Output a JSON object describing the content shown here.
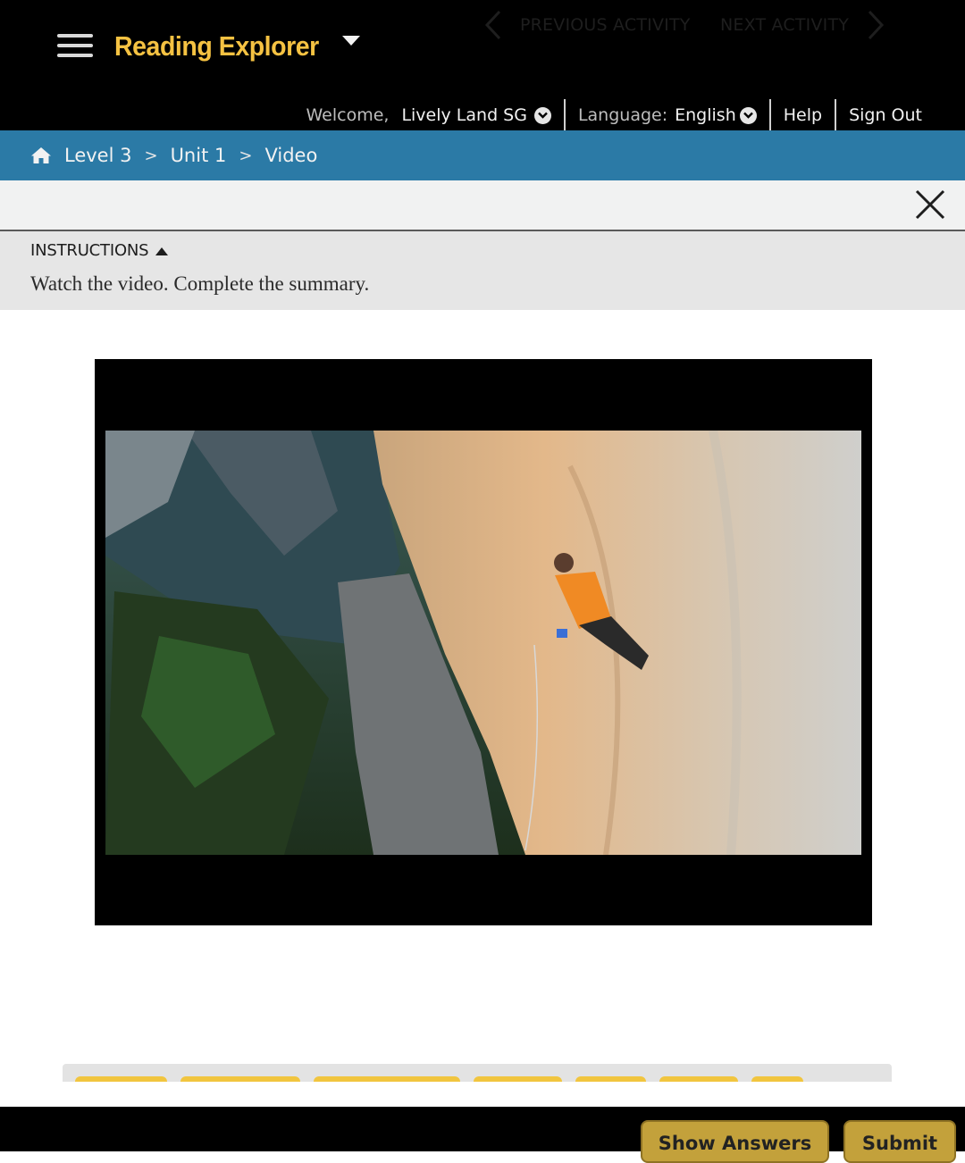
{
  "header": {
    "brand": "Reading Explorer",
    "welcome_label": "Welcome,",
    "user_name": "Lively Land SG",
    "language_label": "Language:",
    "language_value": "English",
    "help": "Help",
    "sign_out": "Sign Out"
  },
  "breadcrumb": {
    "level": "Level 3",
    "unit": "Unit 1",
    "page": "Video",
    "separator": ">"
  },
  "activity_nav": {
    "previous": "PREVIOUS ACTIVITY",
    "next": "NEXT ACTIVITY"
  },
  "instructions": {
    "heading": "INSTRUCTIONS",
    "text": "Watch the video. Complete the summary."
  },
  "footer": {
    "show_answers": "Show Answers",
    "submit": "Submit"
  },
  "colors": {
    "brand_yellow": "#f5c242",
    "breadcrumb_blue": "#2b7aa6",
    "button_gold": "#c3a13b",
    "answer_blank_yellow": "#f1c53f"
  },
  "icons": [
    "menu-icon",
    "caret-down-icon",
    "chevron-down-circle-icon",
    "home-icon",
    "chevron-left-icon",
    "chevron-right-icon",
    "close-icon",
    "triangle-up-icon"
  ]
}
